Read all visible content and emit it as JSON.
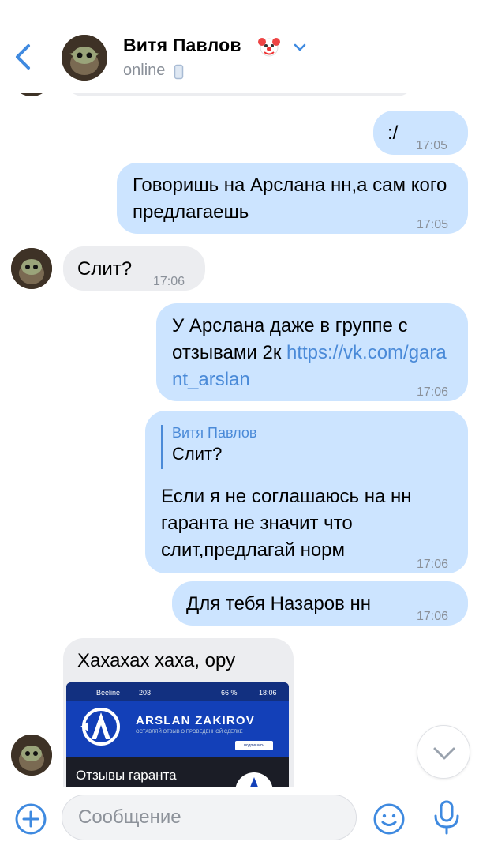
{
  "header": {
    "contact_name": "Витя Павлов",
    "status": "online",
    "name_emoji": "clown-face-icon"
  },
  "messages": [
    {
      "dir": "out",
      "text": ":/",
      "time": "17:05"
    },
    {
      "dir": "out",
      "text": "Говоришь на Арслана нн,а сам кого предлагаешь",
      "time": "17:05"
    },
    {
      "dir": "in",
      "text": "Слит?",
      "time": "17:06"
    },
    {
      "dir": "out",
      "text": "У Арслана даже в группе с отзывами 2к",
      "link": "https://vk.com/garant_arslan",
      "time": "17:06"
    },
    {
      "dir": "out",
      "reply_to_name": "Витя Павлов",
      "reply_to_text": "Слит?",
      "text": "Если я не соглашаюсь на нн гаранта не значит что слит,предлагай норм",
      "time": "17:06"
    },
    {
      "dir": "out",
      "text": "Для тебя Назаров нн",
      "time": "17:06"
    },
    {
      "dir": "in",
      "text": "Хахахах хаха, ору",
      "attachment": {
        "status_left": "Beeline",
        "status_signal": "203",
        "status_battery": "66 %",
        "status_time": "18:06",
        "title": "ARSLAN ZAKIROV",
        "subtitle": "ОСТАВЛЯЙ ОТЗЫВ О ПРОВЕДЕННОЙ СДЕЛКЕ",
        "button": "подпишись",
        "section_label": "Отзывы гаранта"
      }
    }
  ],
  "composer": {
    "placeholder": "Сообщение"
  },
  "colors": {
    "outgoing_bubble": "#cce4ff",
    "incoming_bubble": "#ecedf0",
    "accent": "#4a8ad8",
    "muted_text": "#8a9099"
  }
}
